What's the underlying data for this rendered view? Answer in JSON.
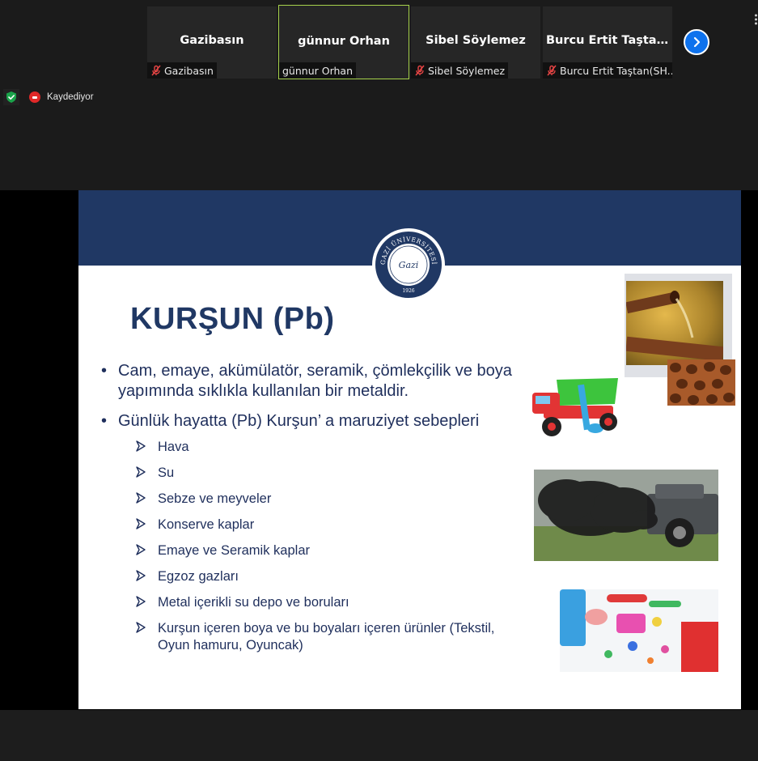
{
  "participants": [
    {
      "display_name": "Gazibasın",
      "label": "Gazibasın",
      "muted": true,
      "active": false
    },
    {
      "display_name": "günnur Orhan",
      "label": "günnur Orhan",
      "muted": false,
      "active": true
    },
    {
      "display_name": "Sibel Söylemez",
      "label": "Sibel Söylemez",
      "muted": true,
      "active": false
    },
    {
      "display_name": "Burcu Ertit Taşta...",
      "label": "Burcu Ertit Taştan(SH...",
      "muted": true,
      "active": false
    }
  ],
  "status": {
    "recording_label": "Kaydediyor"
  },
  "slide": {
    "title": "KURŞUN (Pb)",
    "logo_text": "GAZİ ÜNİVERSİTESİ",
    "logo_signature": "Gazi",
    "logo_year": "1926",
    "bullets": [
      "Cam, emaye, akümülatör, seramik, çömlekçilik ve boya yapımında sıklıkla kullanılan bir metaldir.",
      "Günlük hayatta (Pb) Kurşun’ a maruziyet sebepleri"
    ],
    "sub_items": [
      "Hava",
      "Su",
      "Sebze ve meyveler",
      "Konserve kaplar",
      "Emaye ve Seramik kaplar",
      "Egzoz gazları",
      "Metal içerikli su depo ve boruları",
      "Kurşun içeren boya ve bu boyaları içeren ürünler (Tekstil, Oyun hamuru, Oyuncak)"
    ],
    "bullet_char": "•"
  },
  "colors": {
    "slide_band": "#203864",
    "active_border": "#a6d24b",
    "next_button": "#0e72ed",
    "record": "#e02828",
    "shield": "#1aa34a"
  },
  "icons": {
    "next": "chevron-right-icon",
    "muted": "mic-muted-icon",
    "security": "shield-check-icon",
    "more": "more-vertical-icon"
  }
}
